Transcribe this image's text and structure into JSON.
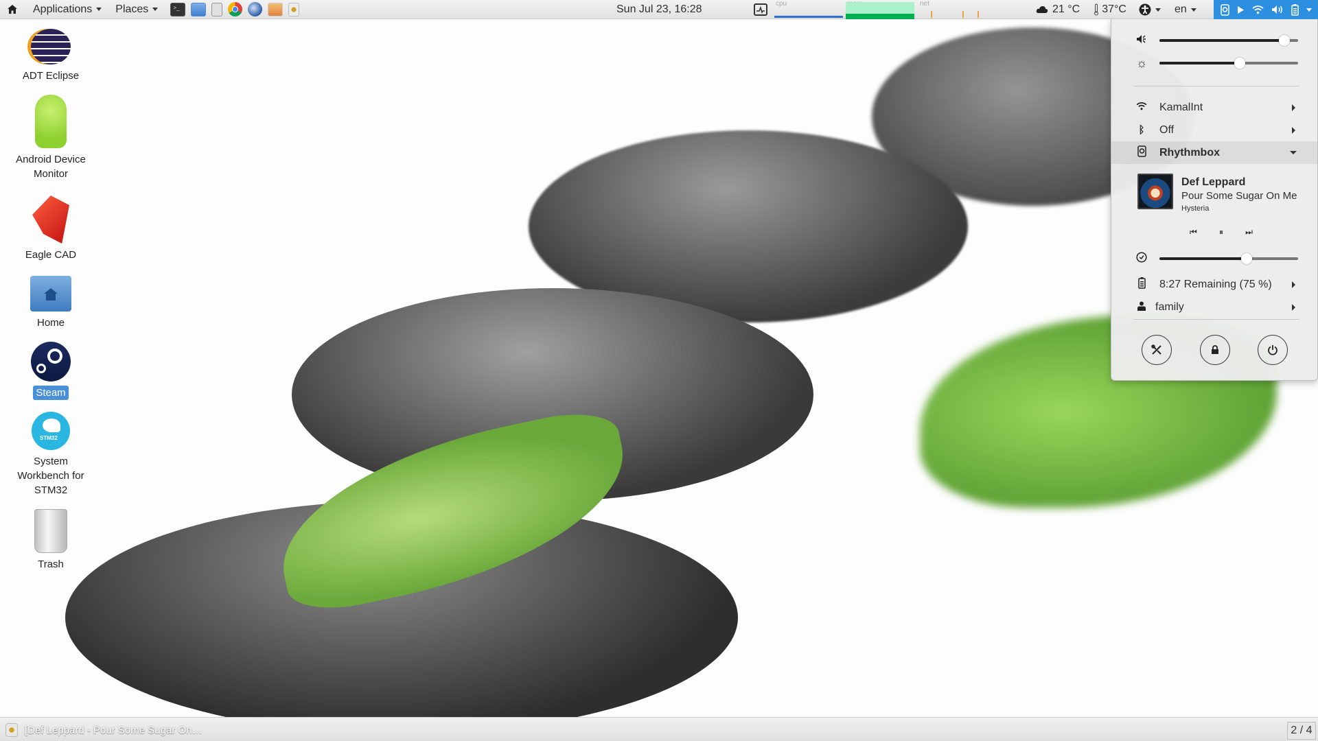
{
  "top_panel": {
    "home_icon": "home-icon",
    "applications_label": "Applications",
    "places_label": "Places",
    "launchers": [
      {
        "name": "terminal",
        "icon": "terminal-icon"
      },
      {
        "name": "display-settings",
        "icon": "monitor-icon"
      },
      {
        "name": "file-cabinet",
        "icon": "cabinet-icon"
      },
      {
        "name": "chrome",
        "icon": "chrome-icon"
      },
      {
        "name": "thunderbird",
        "icon": "thunderbird-icon"
      },
      {
        "name": "image-viewer",
        "icon": "photos-icon"
      },
      {
        "name": "rhythmbox",
        "icon": "rhythmbox-icon"
      }
    ],
    "clock": "Sun Jul 23, 16:28",
    "system_monitor": {
      "cpu_label": "cpu",
      "mem_label": "mem",
      "net_label": "net"
    },
    "weather": "21 °C",
    "temperature": "37°C",
    "keyboard_layout": "en"
  },
  "desktop": {
    "icons": [
      {
        "label": "ADT Eclipse",
        "selected": false
      },
      {
        "label": "Android Device Monitor",
        "selected": false
      },
      {
        "label": "Eagle CAD",
        "selected": false
      },
      {
        "label": "Home",
        "selected": false
      },
      {
        "label": "Steam",
        "selected": true
      },
      {
        "label": "System Workbench for STM32",
        "selected": false
      },
      {
        "label": "Trash",
        "selected": false
      }
    ]
  },
  "system_menu": {
    "volume_level": 0.9,
    "brightness_level": 0.58,
    "wifi": {
      "label": "KamalInt"
    },
    "bluetooth": {
      "label": "Off"
    },
    "media": {
      "player_label": "Rhythmbox",
      "artist": "Def Leppard",
      "title": "Pour Some Sugar On Me",
      "album": "Hysteria",
      "prev_icon": "⏮",
      "pause_icon": "⏸",
      "next_icon": "⏭",
      "timer_level": 0.63
    },
    "battery": {
      "label": "8:27 Remaining (75 %)"
    },
    "user": {
      "label": "family"
    },
    "actions": [
      {
        "name": "settings",
        "glyph": "✂"
      },
      {
        "name": "lock",
        "glyph": "🔒"
      },
      {
        "name": "power",
        "glyph": "⏻"
      }
    ]
  },
  "bottom_panel": {
    "task_label": "[Def Leppard - Pour Some Sugar On…",
    "workspace": "2 / 4"
  },
  "colors": {
    "accent": "#2d8fe0",
    "selection": "#4a90d9",
    "mem_fill": "#00b050"
  }
}
